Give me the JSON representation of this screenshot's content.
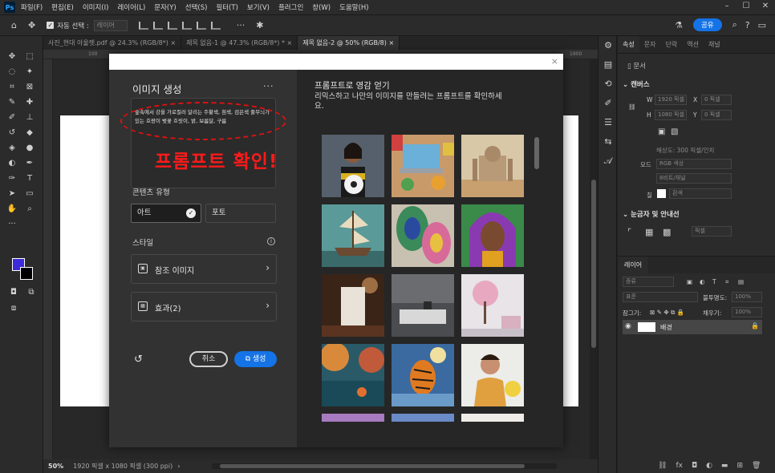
{
  "app": {
    "logo": "Ps",
    "menu": [
      "파일(F)",
      "편집(E)",
      "이미지(I)",
      "레이어(L)",
      "문자(Y)",
      "선택(S)",
      "필터(T)",
      "보기(V)",
      "플러그인",
      "창(W)",
      "도움말(H)"
    ],
    "window_controls": [
      "–",
      "☐",
      "✕"
    ]
  },
  "options_bar": {
    "auto_select_label": "자동 선택 :",
    "auto_select_value": "레이어",
    "share_label": "공유"
  },
  "doc_tabs": [
    {
      "label": "사진_현대 아울렛.pdf @ 24.3% (RGB/8*)",
      "close": "×"
    },
    {
      "label": "제목 없음-1 @ 47.3% (RGB/8*) *",
      "close": "×"
    },
    {
      "label": "제목 없음-2 @ 50% (RGB/8)",
      "close": "×"
    }
  ],
  "ruler_marks": [
    "100",
    "1900"
  ],
  "status": {
    "zoom": "50%",
    "info": "1920 픽셀 x 1080 픽셀 (300 ppi)"
  },
  "dialog": {
    "title": "이미지 생성",
    "more": "···",
    "close": "×",
    "prompt": "숲속에서 강을 가로질러 달리는 주황색, 흰색, 검은색 줄무늬가 있는 호랑이 벚꽃 흐릿이, 밝, 보름달, 구름",
    "annotation": "프롬프트 확인!",
    "content_type_label": "콘텐츠 유형",
    "content_types": [
      "아트",
      "포토"
    ],
    "style_label": "스타일",
    "reference_image_label": "참조 이미지",
    "effects_label": "효과(2)",
    "cancel_label": "취소",
    "generate_label": "생성",
    "inspiration_title": "프롬프트로 영감 얻기",
    "inspiration_desc": "리믹스하고 나만의 이미지를 만들려는 프롬프트를 확인하세요.",
    "thumbnails": [
      "soccer-player",
      "laptop-desk",
      "desert-palace",
      "sailing-ship",
      "peacock-feather",
      "portrait-woman",
      "coffee-bag",
      "marble-table",
      "pink-tree-room",
      "autumn-lake",
      "tiger-water",
      "man-yellow-flowers"
    ]
  },
  "properties_panel": {
    "tabs": [
      "속성",
      "문자",
      "단락",
      "액션",
      "채널"
    ],
    "doc_label": "문서",
    "canvas_heading": "캔버스",
    "w_label": "W",
    "w_value": "1920 픽셀",
    "h_label": "H",
    "h_value": "1080 픽셀",
    "x_label": "X",
    "x_value": "0 픽셀",
    "y_label": "Y",
    "y_value": "0 픽셀",
    "resolution": "해상도: 300 픽셀/인치",
    "mode_label": "모드",
    "mode_value": "RGB 색상",
    "depth_value": "8비트/채널",
    "fill_label": "칠",
    "fill_value": "흰색",
    "guides_heading": "눈금자 및 안내선",
    "guides_unit": "픽셀"
  },
  "layers_panel": {
    "tab": "레이어",
    "kind_filter": "종류",
    "blend_mode": "표준",
    "opacity_label": "불투명도:",
    "opacity_value": "100%",
    "lock_label": "잠그기:",
    "fill_label": "채우기:",
    "fill_value": "100%",
    "layer_name": "배경"
  },
  "colors": {
    "accent": "#1473e6",
    "annotation": "#ff1a1a",
    "foreground": "#3b2bd8",
    "background": "#000000"
  }
}
